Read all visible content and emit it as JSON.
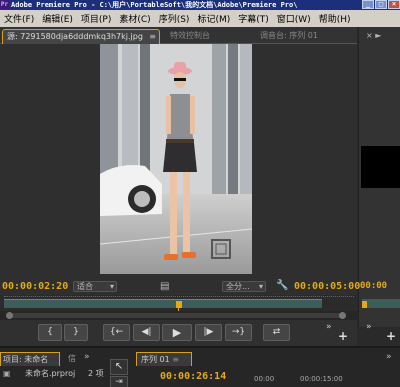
{
  "app": {
    "title": "Adobe Premiere Pro - C:\\用户\\PortableSoft\\我的文档\\Adobe\\Premiere Pro\\",
    "logo": "Pr"
  },
  "menu": [
    "文件(F)",
    "编辑(E)",
    "项目(P)",
    "素材(C)",
    "序列(S)",
    "标记(M)",
    "字幕(T)",
    "窗口(W)",
    "帮助(H)"
  ],
  "tabs": {
    "source": "源: 7291580dja6dddmkq3h7kj.jpg",
    "effects": "特效控制台",
    "mixer": "调音台: 序列 01"
  },
  "monitor": {
    "timecode_left": "00:00:02:20",
    "fit": "适合",
    "quality": "全分...",
    "timecode_right": "00:00:05:00"
  },
  "transport": {
    "mark_in": "{",
    "mark_out": "}",
    "goto_in": "{←",
    "step_back": "◀|",
    "play": "▶",
    "step_fwd": "|▶",
    "goto_out": "→}",
    "insert": "⇄"
  },
  "bottom": {
    "project_tab": "项目: 未命名",
    "project_tab2": "信",
    "project_file": "未命名.prproj",
    "items_count": "2 项",
    "sequence_tab": "序列 01",
    "timecode": "00:00:26:14",
    "ruler1": "00:00",
    "ruler2": "00:00:15:00"
  },
  "right_panel": {
    "timecode": "00:00"
  },
  "colors": {
    "accent": "#e4a917",
    "titlebar": "#1b2f7a"
  }
}
